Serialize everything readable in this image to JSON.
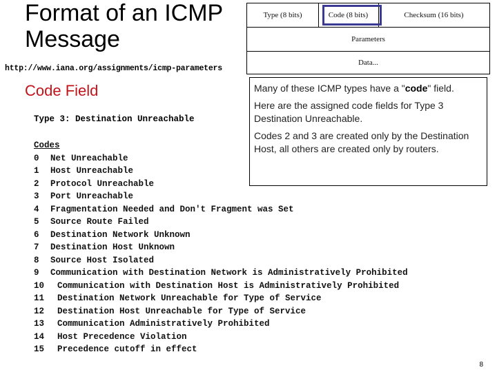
{
  "slide": {
    "title_line1": "Format of an ICMP",
    "title_line2": "Message",
    "url": "http://www.iana.org/assignments/icmp-parameters",
    "subtitle": "Code Field",
    "type_heading": "Type 3: Destination Unreachable",
    "page_number": "8",
    "accent_color": "#c0141a",
    "highlight_color": "#3a3a94"
  },
  "diagram": {
    "type_cell": "Type (8 bits)",
    "code_cell": "Code (8 bits)",
    "checksum_cell": "Checksum (16 bits)",
    "parameters_row": "Parameters",
    "data_row": "Data..."
  },
  "callout": {
    "line1_prefix": "Many of these ICMP types have a \"",
    "line1_bold": "code",
    "line1_suffix": "\" field.",
    "para2": "Here are the assigned code fields for Type 3 Destination Unreachable.",
    "para3": "Codes 2 and 3 are created only by the Destination Host, all others are created only by routers."
  },
  "codes": {
    "header": "Codes",
    "items": [
      {
        "code": "0",
        "desc": "Net Unreachable"
      },
      {
        "code": "1",
        "desc": "Host Unreachable"
      },
      {
        "code": "2",
        "desc": "Protocol Unreachable"
      },
      {
        "code": "3",
        "desc": "Port Unreachable"
      },
      {
        "code": "4",
        "desc": "Fragmentation Needed and Don't Fragment was Set"
      },
      {
        "code": "5",
        "desc": "Source Route Failed"
      },
      {
        "code": "6",
        "desc": "Destination Network Unknown"
      },
      {
        "code": "7",
        "desc": "Destination Host Unknown"
      },
      {
        "code": "8",
        "desc": "Source Host Isolated"
      },
      {
        "code": "9",
        "desc": "Communication with Destination Network is Administratively Prohibited"
      },
      {
        "code": "10",
        "desc": "Communication with Destination Host is Administratively Prohibited"
      },
      {
        "code": "11",
        "desc": "Destination Network Unreachable for Type of Service"
      },
      {
        "code": "12",
        "desc": "Destination Host Unreachable for Type of Service"
      },
      {
        "code": "13",
        "desc": "Communication Administratively Prohibited"
      },
      {
        "code": "14",
        "desc": "Host Precedence Violation"
      },
      {
        "code": "15",
        "desc": "Precedence cutoff in effect"
      }
    ]
  }
}
